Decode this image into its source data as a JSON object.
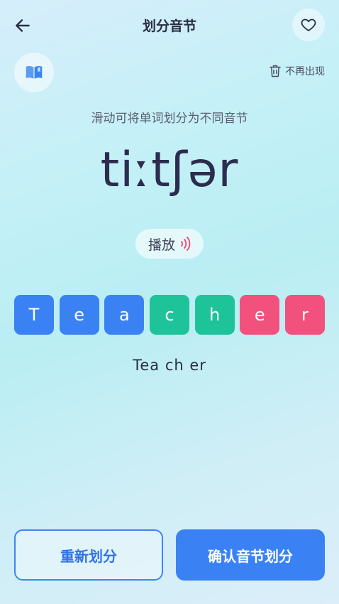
{
  "header": {
    "title": "划分音节",
    "back_icon": "arrow-left-icon",
    "favorite_icon": "heart-icon"
  },
  "book_icon": "book-icon",
  "no_show": {
    "label": "不再出现",
    "icon": "trash-icon"
  },
  "hint": "滑动可将单词划分为不同音节",
  "phonetic": "tiːtʃər",
  "play": {
    "label": "播放",
    "icon": "sound-wave-icon",
    "icon_color": "#f0507a"
  },
  "letters": [
    {
      "char": "T",
      "color": "#3a82f4"
    },
    {
      "char": "e",
      "color": "#3a82f4"
    },
    {
      "char": "a",
      "color": "#3a82f4"
    },
    {
      "char": "c",
      "color": "#1fc39a"
    },
    {
      "char": "h",
      "color": "#1fc39a"
    },
    {
      "char": "e",
      "color": "#f2517e"
    },
    {
      "char": "r",
      "color": "#f2517e"
    }
  ],
  "result": "Tea ch er",
  "buttons": {
    "reset": "重新划分",
    "confirm": "确认音节划分"
  },
  "colors": {
    "accent": "#3a82f4",
    "green": "#1fc39a",
    "pink": "#f2517e"
  }
}
